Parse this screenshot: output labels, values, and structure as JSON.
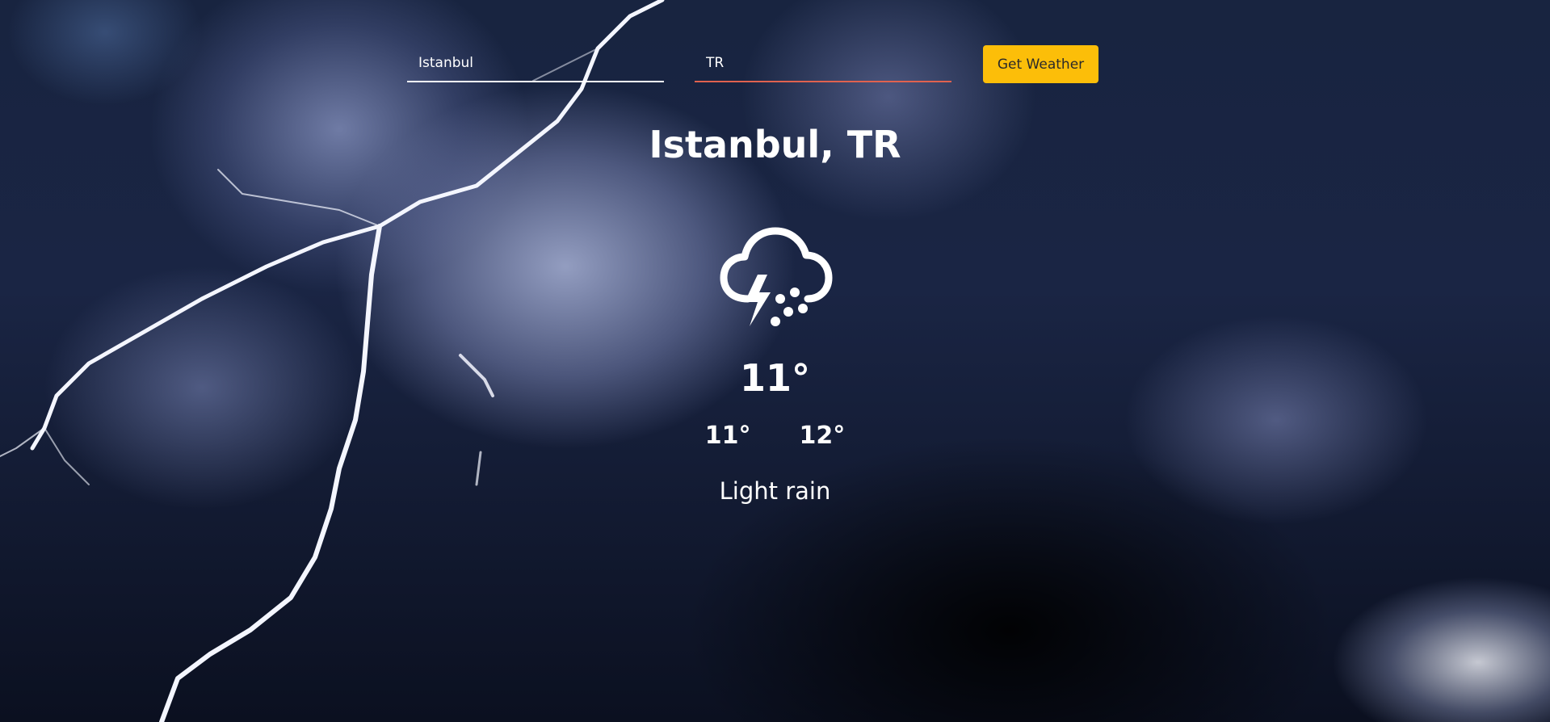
{
  "search": {
    "city_value": "Istanbul",
    "country_value": "TR",
    "button_label": "Get Weather"
  },
  "weather": {
    "location": "Istanbul, TR",
    "icon": "thunderstorm-rain-icon",
    "temperature": "11°",
    "temp_min": "11°",
    "temp_max": "12°",
    "description": "Light rain"
  },
  "colors": {
    "button": "#fcbe09",
    "country_underline": "#e0624f",
    "text": "#ffffff"
  }
}
